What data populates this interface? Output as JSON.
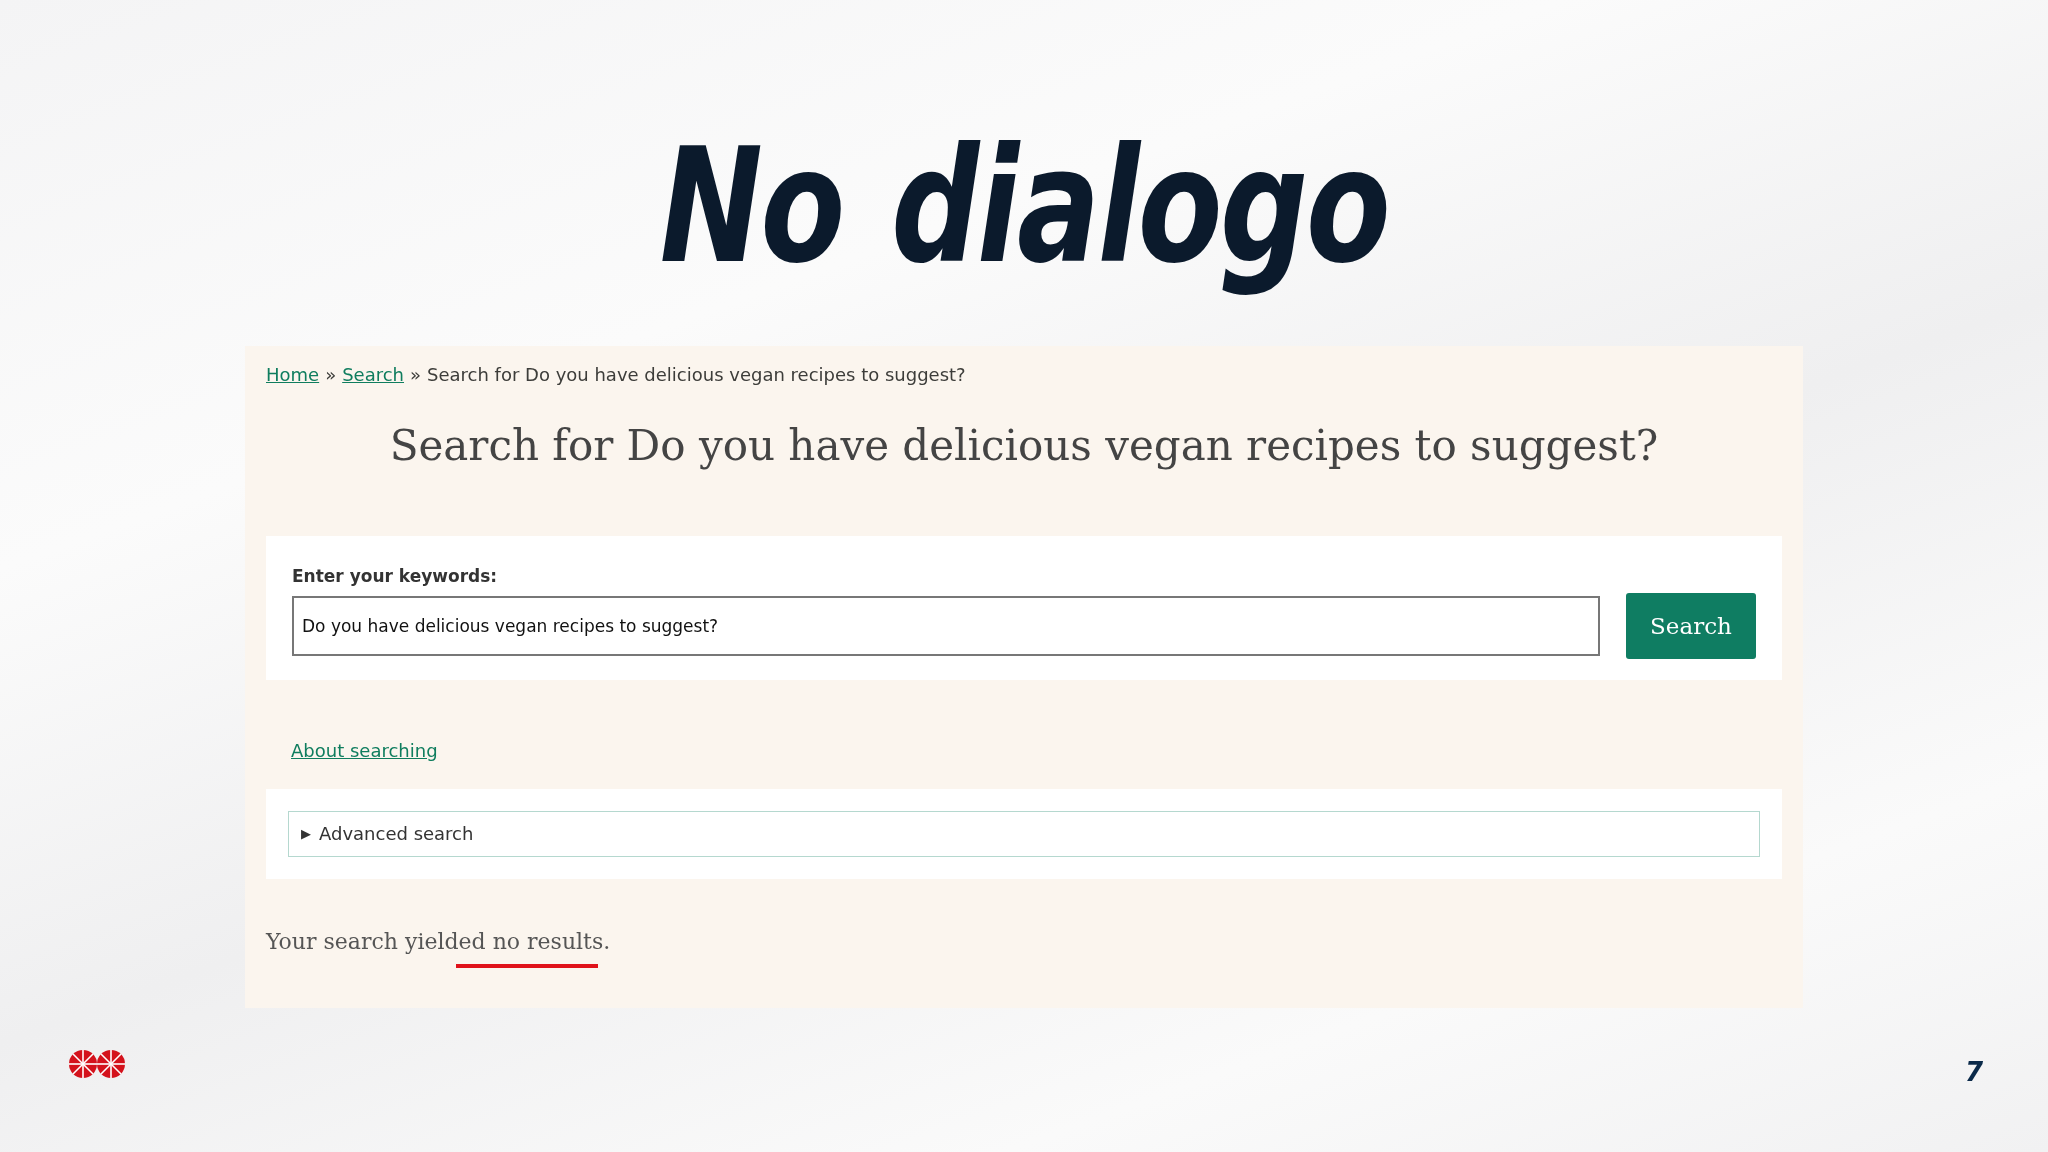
{
  "slide": {
    "title": "No dialogo",
    "page_number": "7"
  },
  "breadcrumb": [
    {
      "label": "Home",
      "kind": "link"
    },
    {
      "label": "»",
      "kind": "separator"
    },
    {
      "label": "Search",
      "kind": "link"
    },
    {
      "label": "»",
      "kind": "separator"
    },
    {
      "label": "Search for Do you have delicious vegan recipes to suggest?",
      "kind": "current"
    }
  ],
  "heading": "Search for Do you have delicious vegan recipes to suggest?",
  "search_form": {
    "label": "Enter your keywords:",
    "value": "Do you have delicious vegan recipes to suggest?",
    "button": "Search"
  },
  "about_link": "About searching",
  "advanced_search": {
    "marker": "▶",
    "label": "Advanced search",
    "expanded": false
  },
  "result_message": "Your search yielded no results."
}
